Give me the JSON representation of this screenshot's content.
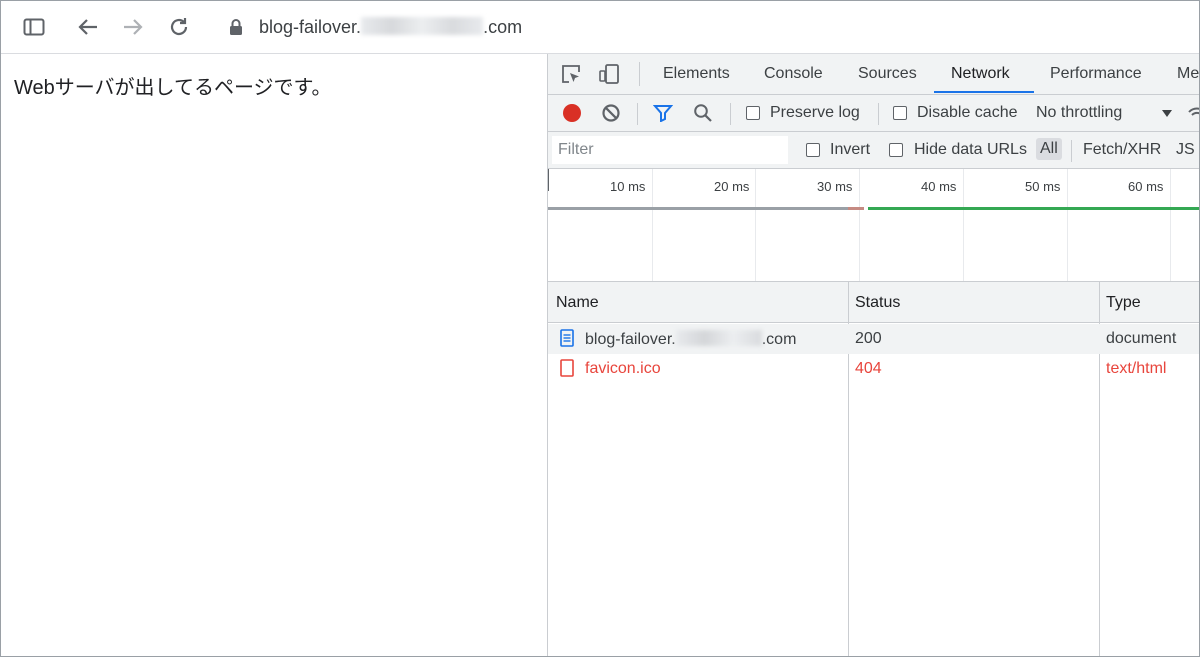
{
  "browser": {
    "url_prefix": "blog-failover.",
    "url_suffix": ".com"
  },
  "page": {
    "text": "Webサーバが出してるページです。"
  },
  "devtools": {
    "tabs": [
      "Elements",
      "Console",
      "Sources",
      "Network",
      "Performance",
      "Me"
    ],
    "active_tab": "Network",
    "toolbar": {
      "preserve_log": "Preserve log",
      "disable_cache": "Disable cache",
      "throttling": "No throttling"
    },
    "filter": {
      "placeholder": "Filter",
      "invert": "Invert",
      "hide_data_urls": "Hide data URLs",
      "types": [
        "All",
        "Fetch/XHR",
        "JS"
      ]
    },
    "timeline_ticks": [
      "10 ms",
      "20 ms",
      "30 ms",
      "40 ms",
      "50 ms",
      "60 ms"
    ],
    "columns": {
      "name": "Name",
      "status": "Status",
      "type": "Type"
    },
    "requests": [
      {
        "name_prefix": "blog-failover.",
        "name_suffix": ".com",
        "status": "200",
        "type": "document",
        "error": false
      },
      {
        "name": "favicon.ico",
        "status": "404",
        "type": "text/html",
        "error": true
      }
    ],
    "colors": {
      "record": "#d93025",
      "accent": "#1a73e8",
      "error": "#e8453c",
      "waterfall_green": "#34a853"
    }
  }
}
